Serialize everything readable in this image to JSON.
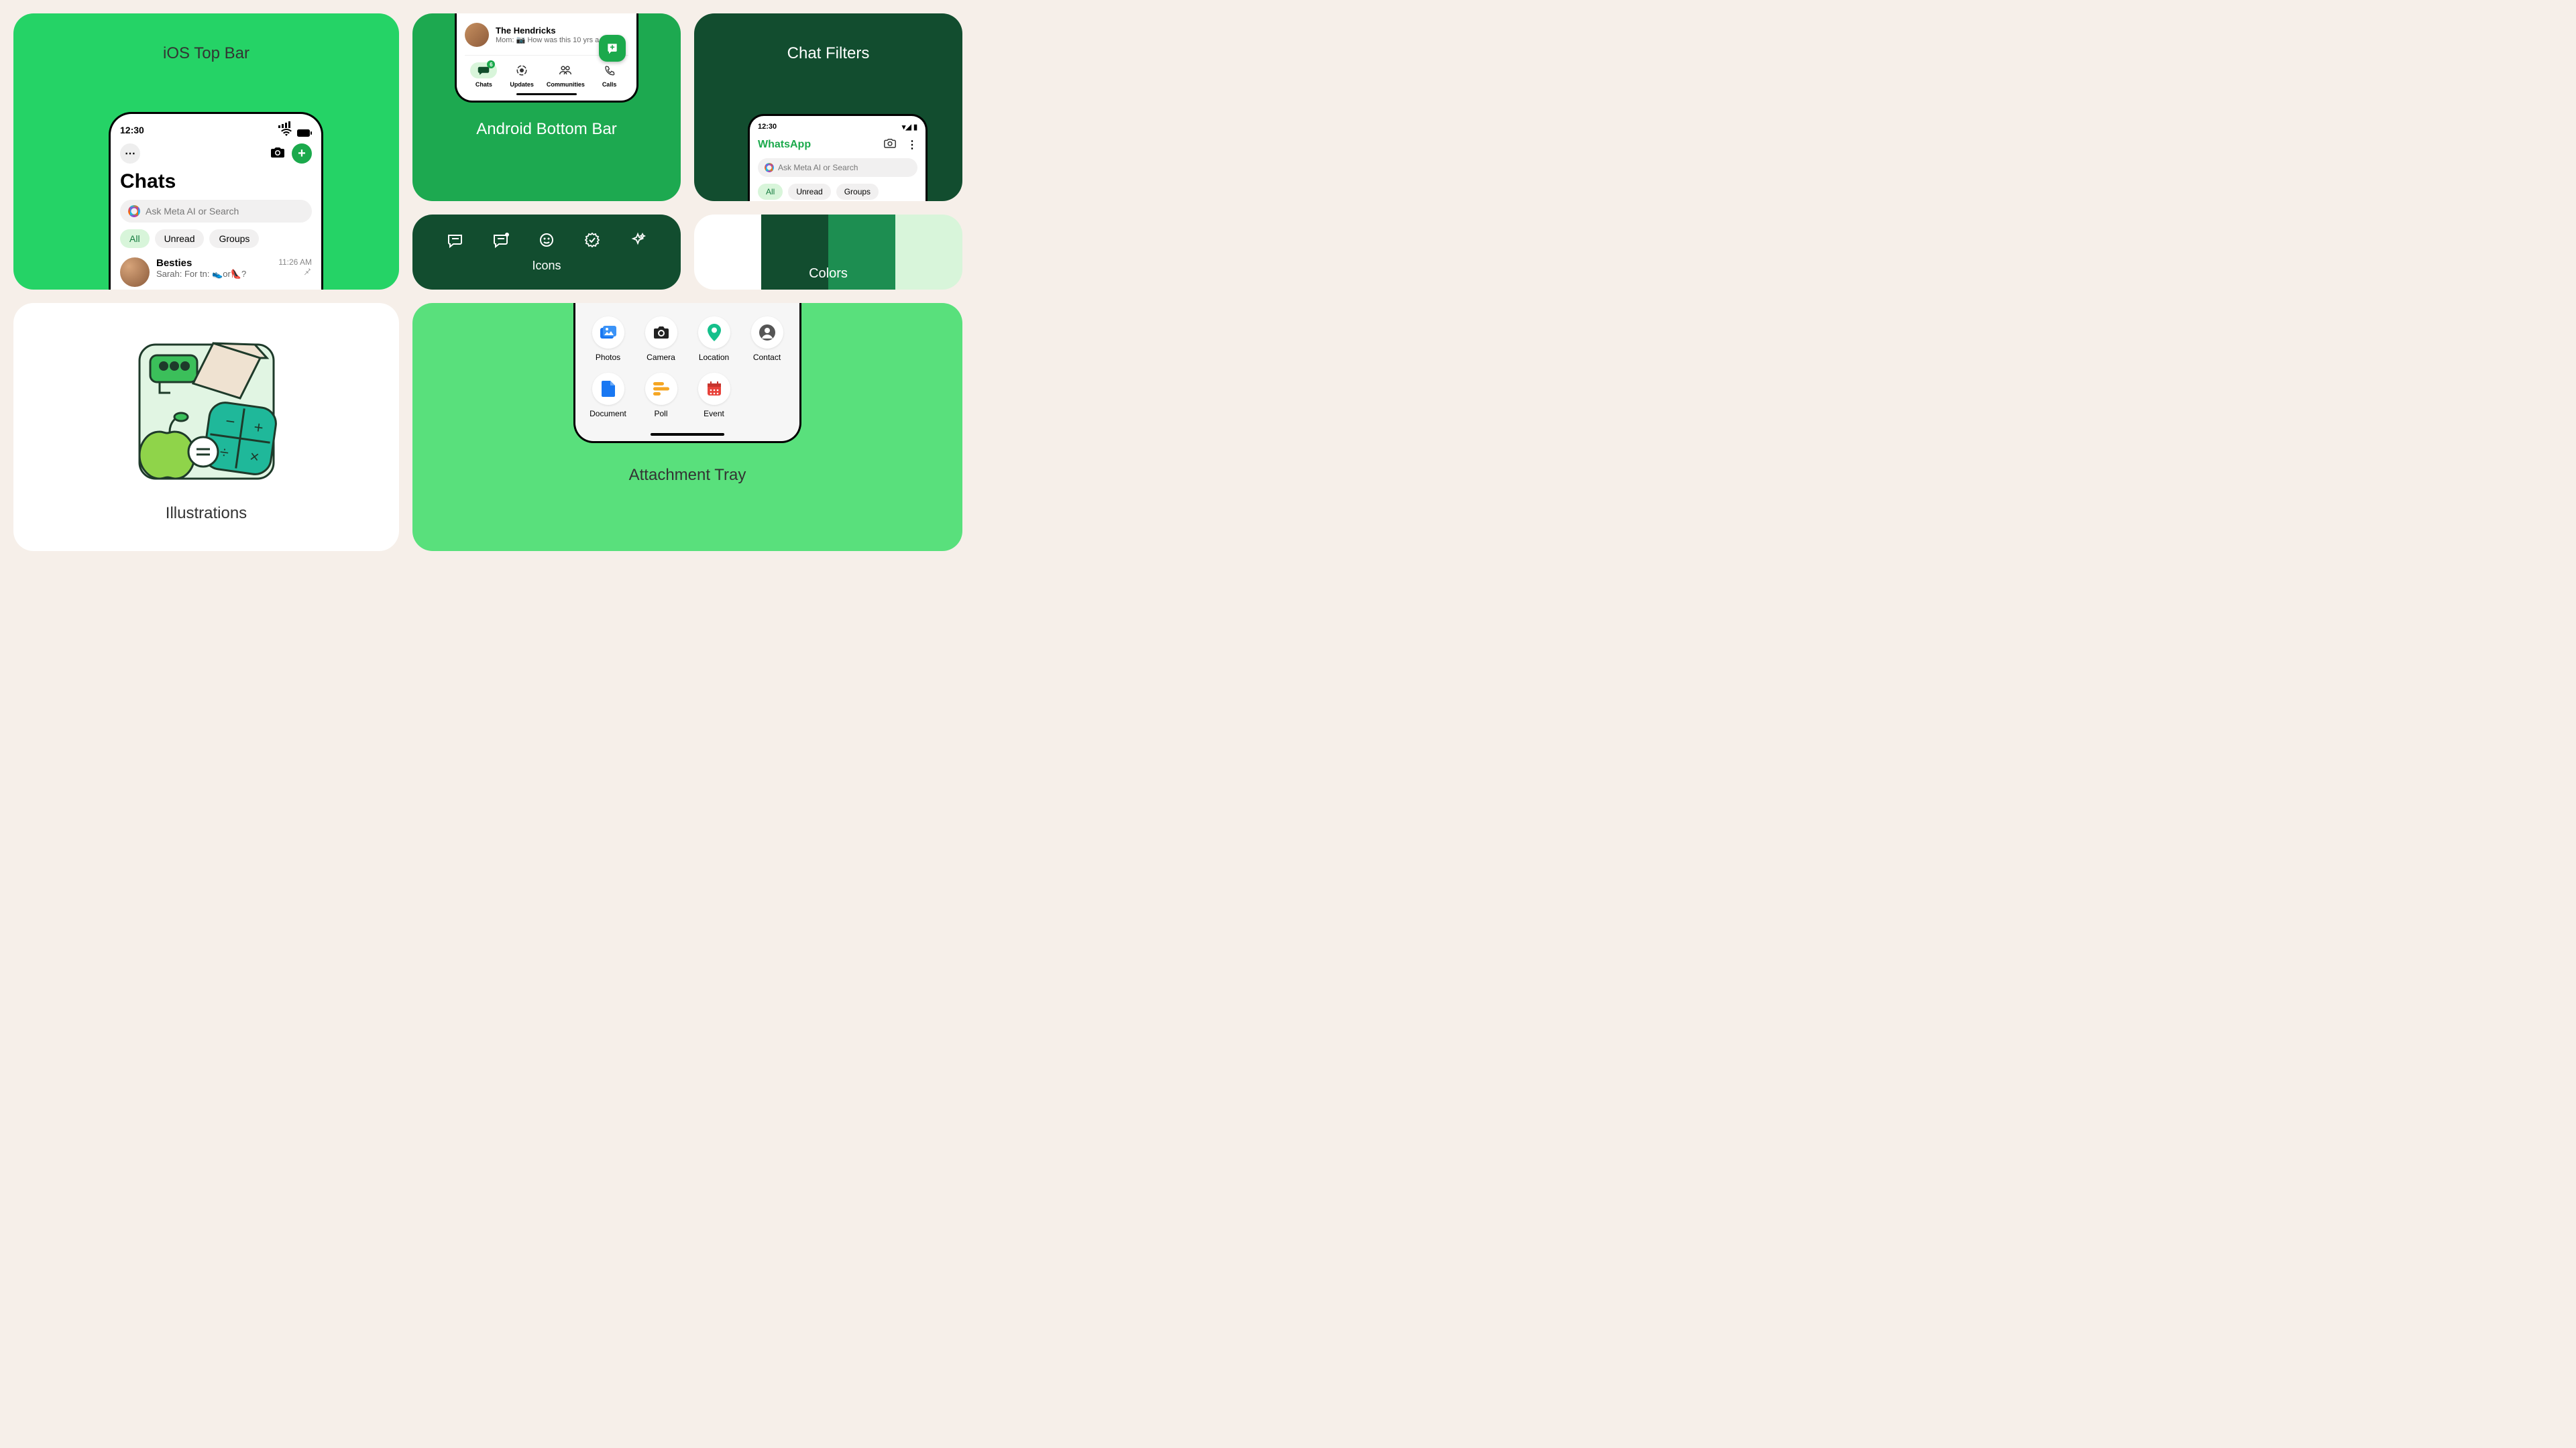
{
  "ios": {
    "label": "iOS Top Bar",
    "time": "12:30",
    "title": "Chats",
    "search_placeholder": "Ask Meta AI or Search",
    "filters": {
      "all": "All",
      "unread": "Unread",
      "groups": "Groups"
    },
    "chat": {
      "name": "Besties",
      "sender": "Sarah:",
      "msg": "For tn: 👟or👠?",
      "time": "11:26 AM"
    }
  },
  "android": {
    "label": "Android Bottom Bar",
    "chat": {
      "name": "The Hendricks",
      "sender": "Mom:",
      "msg": "📷 How was this 10 yrs a…"
    },
    "nav": {
      "chats": "Chats",
      "updates": "Updates",
      "communities": "Communities",
      "calls": "Calls",
      "badge": "6"
    }
  },
  "icons": {
    "label": "Icons"
  },
  "filters_card": {
    "label": "Chat Filters",
    "time": "12:30",
    "app": "WhatsApp",
    "search_placeholder": "Ask Meta AI or Search",
    "filters": {
      "all": "All",
      "unread": "Unread",
      "groups": "Groups"
    }
  },
  "colors": {
    "label": "Colors",
    "swatches": [
      "#ffffff",
      "#124d2f",
      "#1d8e51",
      "#d8f5da"
    ]
  },
  "illustrations": {
    "label": "Illustrations"
  },
  "attach": {
    "label": "Attachment Tray",
    "items": {
      "photos": "Photos",
      "camera": "Camera",
      "location": "Location",
      "contact": "Contact",
      "document": "Document",
      "poll": "Poll",
      "event": "Event"
    }
  }
}
